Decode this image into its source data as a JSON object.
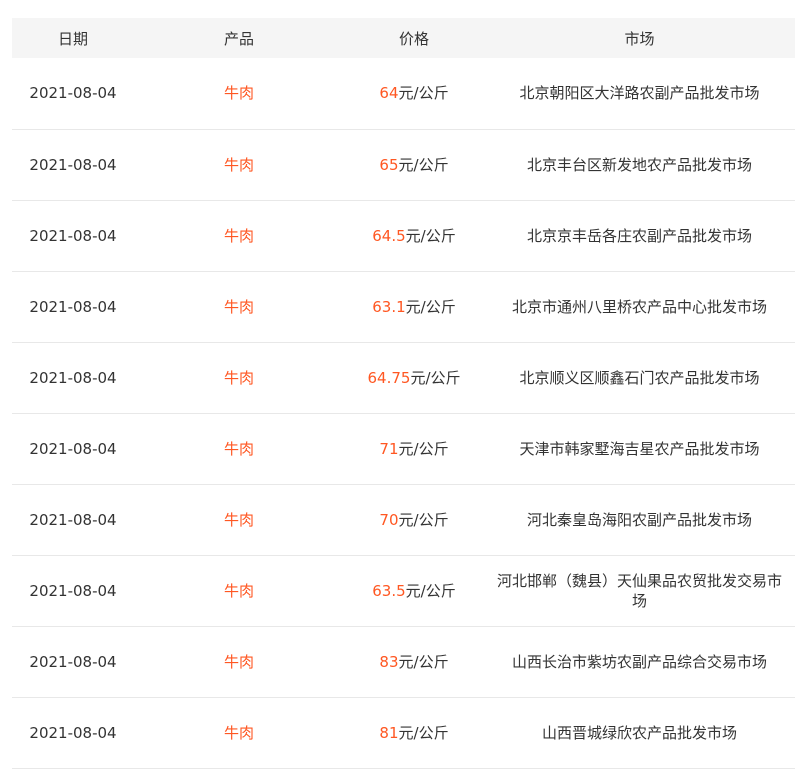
{
  "colors": {
    "accent": "#ff5722",
    "header_bg": "#f5f5f5",
    "text": "#333333",
    "divider": "#e8e8e8"
  },
  "table": {
    "headers": [
      "日期",
      "产品",
      "价格",
      "市场"
    ],
    "rows": [
      {
        "date": "2021-08-04",
        "product": "牛肉",
        "price": "64",
        "unit": "元/公斤",
        "market": "北京朝阳区大洋路农副产品批发市场"
      },
      {
        "date": "2021-08-04",
        "product": "牛肉",
        "price": "65",
        "unit": "元/公斤",
        "market": "北京丰台区新发地农产品批发市场"
      },
      {
        "date": "2021-08-04",
        "product": "牛肉",
        "price": "64.5",
        "unit": "元/公斤",
        "market": "北京京丰岳各庄农副产品批发市场"
      },
      {
        "date": "2021-08-04",
        "product": "牛肉",
        "price": "63.1",
        "unit": "元/公斤",
        "market": "北京市通州八里桥农产品中心批发市场"
      },
      {
        "date": "2021-08-04",
        "product": "牛肉",
        "price": "64.75",
        "unit": "元/公斤",
        "market": "北京顺义区顺鑫石门农产品批发市场"
      },
      {
        "date": "2021-08-04",
        "product": "牛肉",
        "price": "71",
        "unit": "元/公斤",
        "market": "天津市韩家墅海吉星农产品批发市场"
      },
      {
        "date": "2021-08-04",
        "product": "牛肉",
        "price": "70",
        "unit": "元/公斤",
        "market": "河北秦皇岛海阳农副产品批发市场"
      },
      {
        "date": "2021-08-04",
        "product": "牛肉",
        "price": "63.5",
        "unit": "元/公斤",
        "market": "河北邯郸（魏县）天仙果品农贸批发交易市场"
      },
      {
        "date": "2021-08-04",
        "product": "牛肉",
        "price": "83",
        "unit": "元/公斤",
        "market": "山西长治市紫坊农副产品综合交易市场"
      },
      {
        "date": "2021-08-04",
        "product": "牛肉",
        "price": "81",
        "unit": "元/公斤",
        "market": "山西晋城绿欣农产品批发市场"
      }
    ]
  }
}
